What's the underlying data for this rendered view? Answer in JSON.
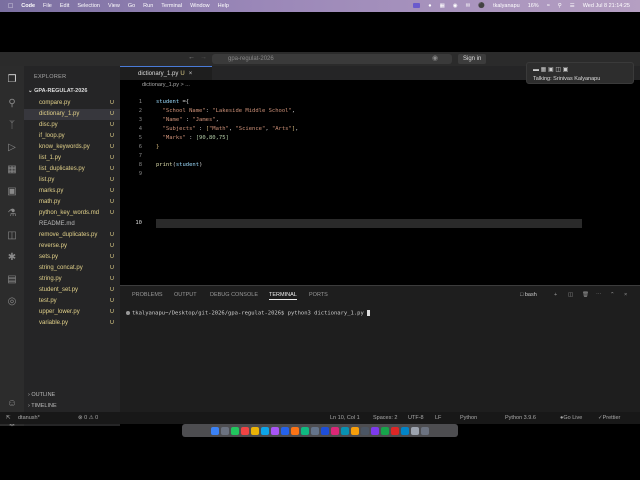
{
  "menubar": {
    "app_name": "Code",
    "items": [
      "File",
      "Edit",
      "Selection",
      "View",
      "Go",
      "Run",
      "Terminal",
      "Window",
      "Help"
    ],
    "user": "tkalyanapu",
    "battery": "16%",
    "datetime": "Wed Jul 8  21:14:25"
  },
  "titlebar": {
    "search_placeholder": "gpa-regulat-2026",
    "sign_in": "Sign in"
  },
  "notification": {
    "text": "Talking: Srinivas Kalyanapu"
  },
  "sidebar": {
    "header": "EXPLORER",
    "project": "GPA-REGULAT-2026",
    "files": [
      {
        "name": "compare.py",
        "status": "U"
      },
      {
        "name": "dictionary_1.py",
        "status": "U"
      },
      {
        "name": "disc.py",
        "status": "U"
      },
      {
        "name": "if_loop.py",
        "status": "U"
      },
      {
        "name": "know_keywords.py",
        "status": "U"
      },
      {
        "name": "list_1.py",
        "status": "U"
      },
      {
        "name": "list_duplicates.py",
        "status": "U"
      },
      {
        "name": "list.py",
        "status": "U"
      },
      {
        "name": "marks.py",
        "status": "U"
      },
      {
        "name": "math.py",
        "status": "U"
      },
      {
        "name": "python_key_words.md",
        "status": "U"
      },
      {
        "name": "README.md",
        "status": ""
      },
      {
        "name": "remove_duplicates.py",
        "status": "U"
      },
      {
        "name": "reverse.py",
        "status": "U"
      },
      {
        "name": "sets.py",
        "status": "U"
      },
      {
        "name": "string_concat.py",
        "status": "U"
      },
      {
        "name": "string.py",
        "status": "U"
      },
      {
        "name": "student_set.py",
        "status": "U"
      },
      {
        "name": "test.py",
        "status": "U"
      },
      {
        "name": "upper_lower.py",
        "status": "U"
      },
      {
        "name": "variable.py",
        "status": "U"
      }
    ],
    "outline": "OUTLINE",
    "timeline": "TIMELINE"
  },
  "editor": {
    "tab_name": "dictionary_1.py",
    "tab_status": "U",
    "breadcrumb": "dictionary_1.py > ...",
    "line_numbers": [
      "1",
      "2",
      "3",
      "4",
      "5",
      "6",
      "7",
      "8",
      "9",
      "10"
    ],
    "lines": {
      "l1_var": "student",
      "l1_rest": " ={",
      "l2_key": "\"School Name\"",
      "l2_val": "\"Lakeside Middle School\"",
      "l3_key": "\"Name\"",
      "l3_val": "\"James\"",
      "l4_key": "\"Subjects\"",
      "l4_val1": "\"Math\"",
      "l4_val2": "\"Science\"",
      "l4_val3": "\"Arts\"",
      "l5_key": "\"Marks\"",
      "l5_val": "[90,80,75]",
      "l6": "}",
      "l8_fn": "print",
      "l8_arg": "student"
    }
  },
  "panel": {
    "tabs": [
      "PROBLEMS",
      "OUTPUT",
      "DEBUG CONSOLE",
      "TERMINAL",
      "PORTS"
    ],
    "active_tab": "TERMINAL",
    "shell": "bash",
    "prompt": "tkalyanapu~/Desktop/git-2026/gpa-regulat-2026$",
    "command": " python3 dictionary_1.py "
  },
  "statusbar": {
    "branch": "dtanush*",
    "errors": "⊗ 0  ⚠ 0",
    "position": "Ln 10, Col 1",
    "spaces": "Spaces: 2",
    "encoding": "UTF-8",
    "eol": "LF",
    "language": "Python",
    "interpreter": "Python 3.9.6",
    "golive": "Go Live",
    "prettier": "Prettier"
  },
  "colors": {
    "accent": "#4a7bd8",
    "untracked": "#e3d28a",
    "string": "#ce9178",
    "variable": "#9cdcfe"
  }
}
